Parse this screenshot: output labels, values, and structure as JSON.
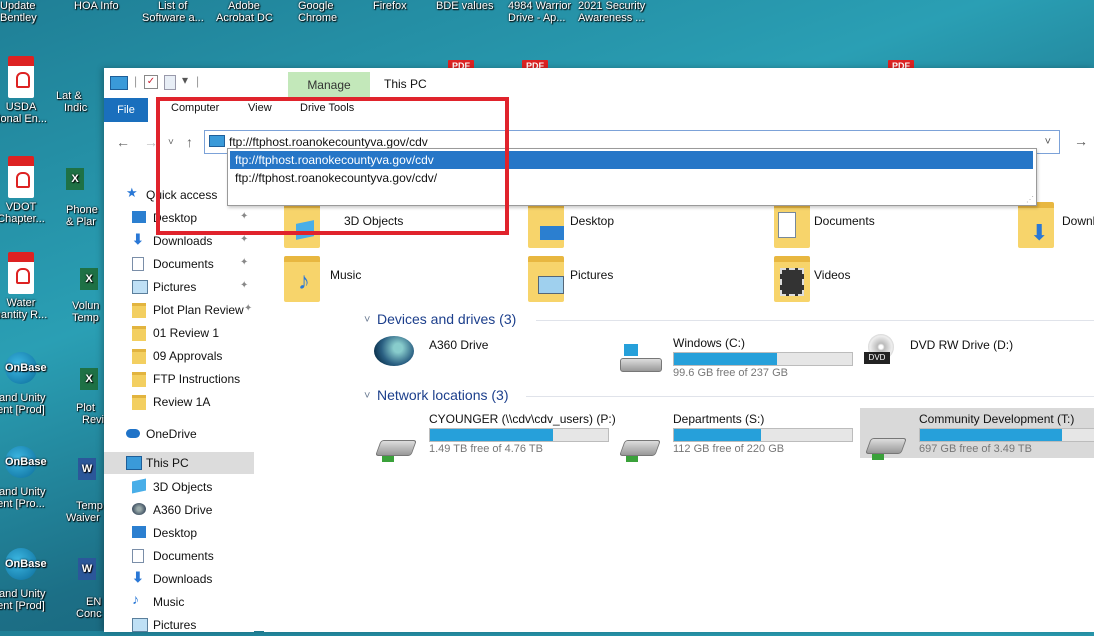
{
  "desktop": {
    "top_labels": [
      {
        "line1": "Update",
        "line2": "Bentley"
      },
      {
        "line1": "HOA Info",
        "line2": ""
      },
      {
        "line1": "List of",
        "line2": "Software a..."
      },
      {
        "line1": "Adobe",
        "line2": "Acrobat DC"
      },
      {
        "line1": "Google",
        "line2": "Chrome"
      },
      {
        "line1": "Firefox",
        "line2": ""
      },
      {
        "line1": "BDE values",
        "line2": ""
      },
      {
        "line1": "4984 Warrior",
        "line2": "Drive - Ap..."
      },
      {
        "line1": "2021 Security",
        "line2": "Awareness ..."
      }
    ],
    "left_icons": [
      {
        "label": "USDA",
        "label2": "tional En...",
        "kind": "pdf"
      },
      {
        "label": "VDOT",
        "label2": "Chapter...",
        "kind": "pdf"
      },
      {
        "label": "Water",
        "label2": "uantity R...",
        "kind": "pdf"
      },
      {
        "label": "OnBase",
        "label2": "land Unity",
        "label3": "ent [Prod]",
        "kind": "onbase"
      },
      {
        "label": "OnBase",
        "label2": "land Unity",
        "label3": "ent [Pro...",
        "kind": "onbase"
      },
      {
        "label": "OnBase",
        "label2": "land Unity",
        "label3": "ent [Prod]",
        "kind": "onbase"
      }
    ],
    "second_col": [
      {
        "label": "Lat &",
        "label2": "Indic"
      },
      {
        "label": "Phone",
        "label2": "& Plar"
      },
      {
        "label": "Volun",
        "label2": "Temp"
      },
      {
        "label": "Plot",
        "label2": "Revi"
      },
      {
        "label": "Temp",
        "label2": "Waiver"
      },
      {
        "label": "EN",
        "label2": "Conc"
      }
    ],
    "pdf_badge": "PDF"
  },
  "window": {
    "title": "This PC",
    "manage_tab": "Manage",
    "ribbon_tabs": [
      "File",
      "Computer",
      "View",
      "Drive Tools"
    ],
    "address": "ftp://ftphost.roanokecountyva.gov/cdv",
    "autocomplete": [
      "ftp://ftphost.roanokecountyva.gov/cdv",
      "ftp://ftphost.roanokecountyva.gov/cdv/"
    ]
  },
  "nav": {
    "items": [
      {
        "label": "Quick access",
        "icon": "star-icon",
        "pinned": false
      },
      {
        "label": "Desktop",
        "icon": "desktop-icon",
        "pinned": true
      },
      {
        "label": "Downloads",
        "icon": "download-icon",
        "pinned": true
      },
      {
        "label": "Documents",
        "icon": "document-icon",
        "pinned": true
      },
      {
        "label": "Pictures",
        "icon": "pictures-icon",
        "pinned": true
      },
      {
        "label": "Plot Plan Review",
        "icon": "folder-icon",
        "pinned": true
      },
      {
        "label": "01 Review 1",
        "icon": "folder-icon",
        "pinned": false
      },
      {
        "label": "09 Approvals",
        "icon": "folder-icon",
        "pinned": false
      },
      {
        "label": "FTP Instructions",
        "icon": "folder-icon",
        "pinned": false
      },
      {
        "label": "Review 1A",
        "icon": "folder-icon",
        "pinned": false
      },
      {
        "label": "OneDrive",
        "icon": "cloud-icon",
        "pinned": false
      },
      {
        "label": "This PC",
        "icon": "pc-icon",
        "pinned": false
      },
      {
        "label": "3D Objects",
        "icon": "3d-icon",
        "pinned": false
      },
      {
        "label": "A360 Drive",
        "icon": "a360-icon",
        "pinned": false
      },
      {
        "label": "Desktop",
        "icon": "desktop-icon",
        "pinned": false
      },
      {
        "label": "Documents",
        "icon": "document-icon",
        "pinned": false
      },
      {
        "label": "Downloads",
        "icon": "download-icon",
        "pinned": false
      },
      {
        "label": "Music",
        "icon": "music-icon",
        "pinned": false
      },
      {
        "label": "Pictures",
        "icon": "pictures-icon",
        "pinned": false
      }
    ],
    "pin_glyph": "📌"
  },
  "content": {
    "folders": [
      {
        "name": "3D Objects"
      },
      {
        "name": "Desktop"
      },
      {
        "name": "Documents"
      },
      {
        "name": "Downlo"
      },
      {
        "name": "Music"
      },
      {
        "name": "Pictures"
      },
      {
        "name": "Videos"
      }
    ],
    "devices_heading": "Devices and drives (3)",
    "drives": [
      {
        "name": "A360 Drive",
        "free": "",
        "used_fraction": null
      },
      {
        "name": "Windows (C:)",
        "free": "99.6 GB free of 237 GB",
        "used_fraction": 0.58
      },
      {
        "name": "DVD RW Drive (D:)",
        "free": "",
        "used_fraction": null
      }
    ],
    "dvd_label": "DVD",
    "network_heading": "Network locations (3)",
    "network": [
      {
        "name": "CYOUNGER (\\\\cdv\\cdv_users) (P:)",
        "free": "1.49 TB free of 4.76 TB",
        "used_fraction": 0.69
      },
      {
        "name": "Departments (S:)",
        "free": "112 GB free of 220 GB",
        "used_fraction": 0.49
      },
      {
        "name": "Community Development (T:)",
        "free": "697 GB free of 3.49 TB",
        "used_fraction": 0.8
      }
    ]
  },
  "colors": {
    "highlight": "#e0232c",
    "accent": "#26a0da",
    "manage_tab": "#c3e8ba"
  }
}
